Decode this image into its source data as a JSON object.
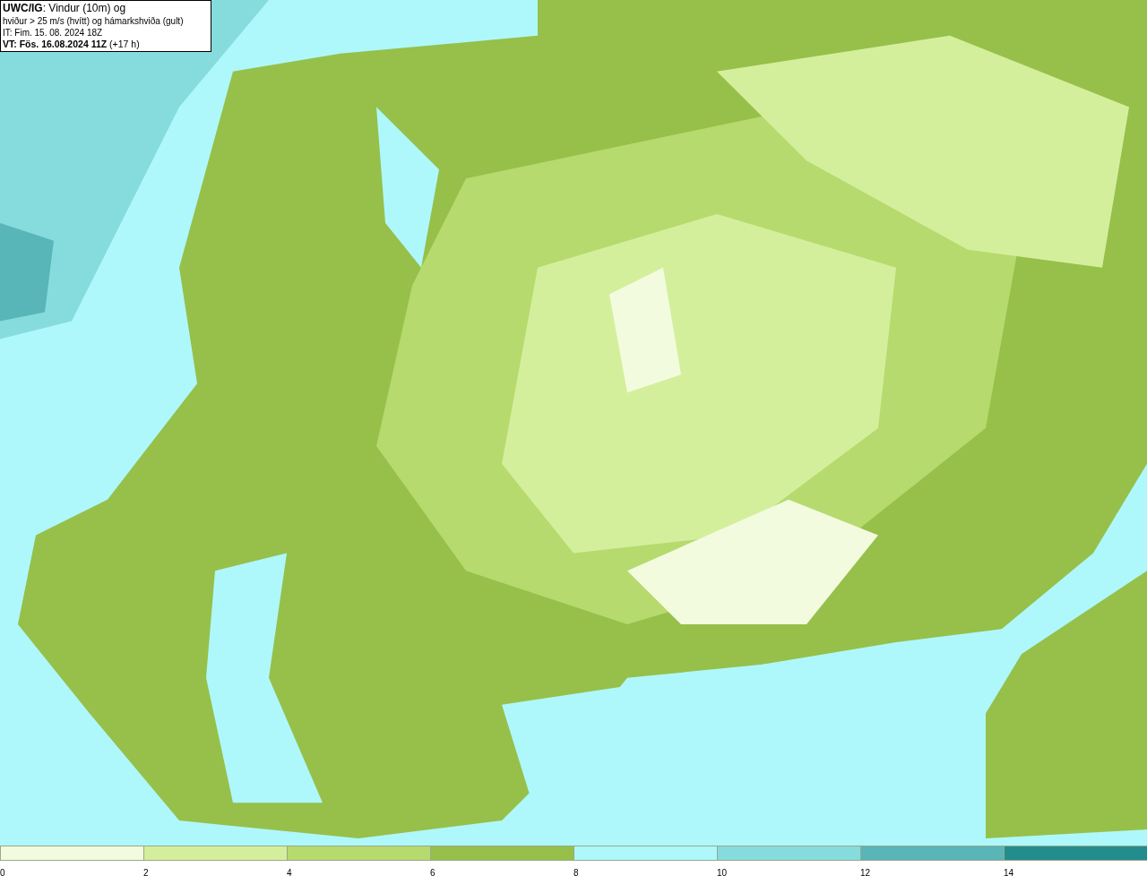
{
  "title_box": {
    "lines": [
      "**UWC/IG**: Vindur (10m) og",
      "hviður > 25 m/s (hvítt) og hámarkshviða (gult)",
      "IT: Fim. 15. 08. 2024 18Z",
      "**VT: Fös. 16.08.2024 11Z** (+17 h)"
    ]
  },
  "legend": {
    "segments": [
      {
        "color": "#f3fbdf"
      },
      {
        "color": "#d4ef9c"
      },
      {
        "color": "#b6da6e"
      },
      {
        "color": "#96c04a"
      },
      {
        "color": "#aef8fb"
      },
      {
        "color": "#86dcdd"
      },
      {
        "color": "#58b5b8"
      },
      {
        "color": "#238d8d"
      }
    ],
    "labels": [
      "0",
      "2",
      "4",
      "6",
      "8",
      "10",
      "12",
      "14"
    ]
  }
}
